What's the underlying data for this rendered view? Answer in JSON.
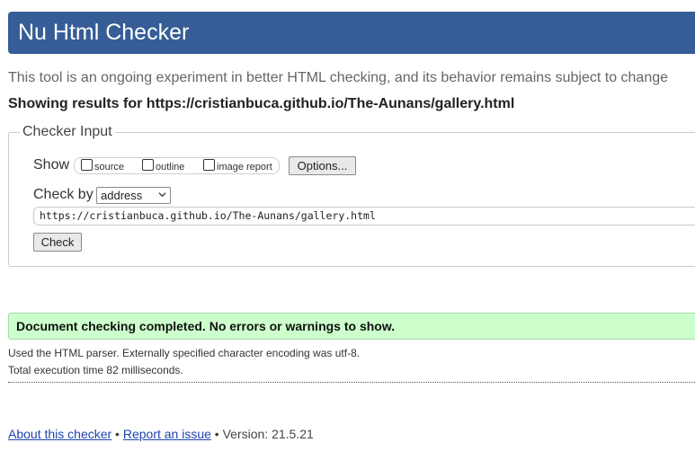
{
  "header": {
    "title": "Nu Html Checker",
    "color": "#365d95"
  },
  "tagline": "This tool is an ongoing experiment in better HTML checking, and its behavior remains subject to change",
  "showing_results": "Showing results for https://cristianbuca.github.io/The-Aunans/gallery.html",
  "checker_input": {
    "legend": "Checker Input",
    "show_label": "Show",
    "options": {
      "source": "source",
      "outline": "outline",
      "image_report": "image report"
    },
    "options_button": "Options...",
    "check_by_label": "Check by",
    "check_by_selected": "address",
    "url_value": "https://cristianbuca.github.io/The-Aunans/gallery.html",
    "check_button": "Check"
  },
  "result": {
    "message": "Document checking completed. No errors or warnings to show.",
    "color": "#ccffcc",
    "parser_info": "Used the HTML parser. Externally specified character encoding was utf-8.",
    "execution_time": "Total execution time 82 milliseconds."
  },
  "footer": {
    "about_link": "About this checker",
    "separator_1": " • ",
    "report_link": "Report an issue",
    "separator_2": " • ",
    "version": "Version: 21.5.21",
    "link_color": "#2044b0"
  }
}
